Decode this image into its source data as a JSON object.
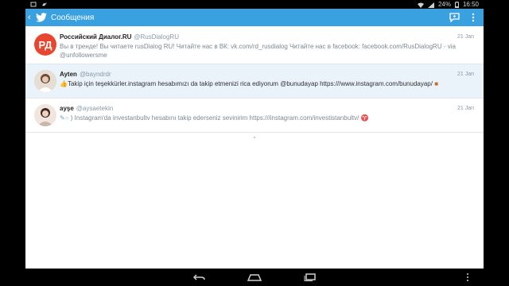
{
  "status": {
    "battery": "24%",
    "time": "16:50"
  },
  "actionbar": {
    "title": "Сообщения",
    "back_icon": "back-arrow-icon",
    "app_icon": "twitter-bird-icon",
    "accent": "#3aa1e0"
  },
  "messages": [
    {
      "name": "Российский Диалог.RU",
      "handle": "@RusDialogRU",
      "date": "21 Jan",
      "text": "Вы в тренде! Вы читаете rusDialog RU! Читайте нас в ВК: vk.com/rd_rusdialog Читайте нас в facebook: facebook.com/RusDialogRU - via @unfollowersme",
      "selected": false
    },
    {
      "name": "Ayten",
      "handle": "@bayndrdr",
      "date": "21 Jan",
      "text": "Takip için teşekkürler.instagram hesabımızı da takip etmenizi rica ediyorum @bunudayap https:///www.instagram.com/bunudayap/",
      "selected": true
    },
    {
      "name": "ayşe",
      "handle": "@aysaetekin",
      "date": "21 Jan",
      "text": ") Instagram'da investanbultv hesabını takip ederseniz sevinirim https:///instagram.com/investistanbultv/",
      "selected": false
    }
  ]
}
